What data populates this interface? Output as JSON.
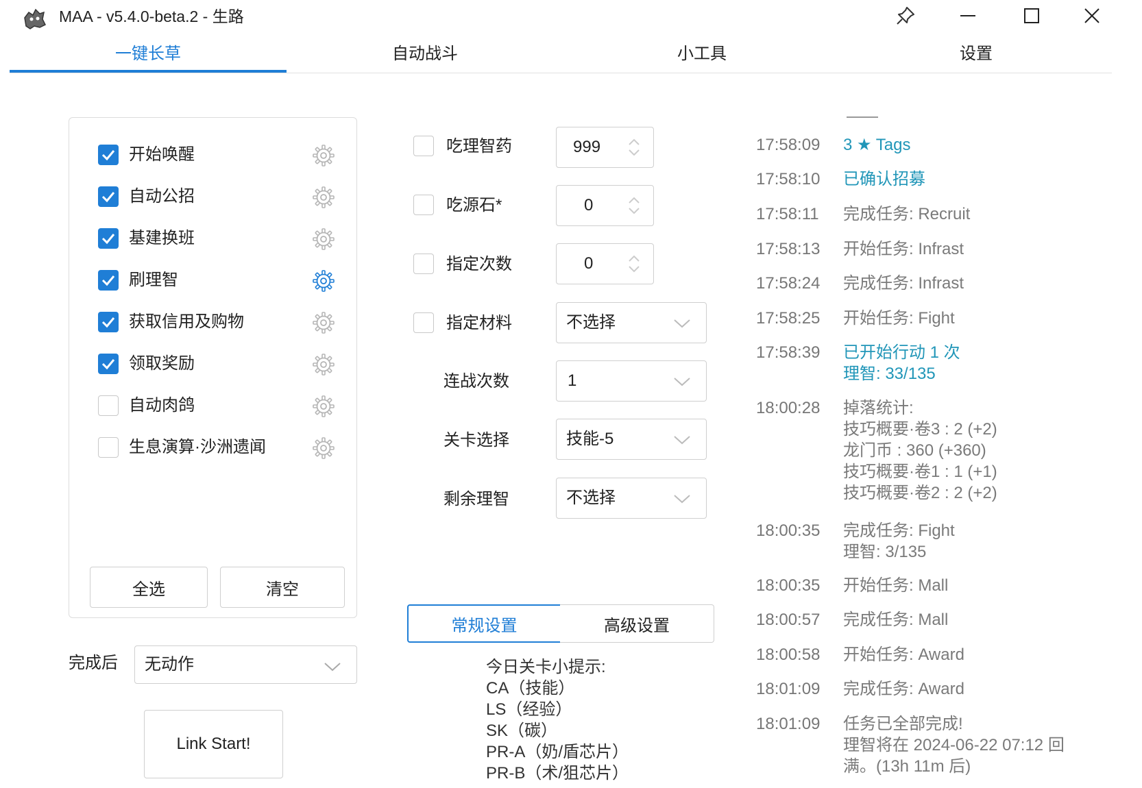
{
  "window": {
    "title": "MAA - v5.4.0-beta.2 - 生路",
    "buttons": {
      "pin": "pin-icon",
      "minimize": "minimize-icon",
      "maximize": "maximize-icon",
      "close": "close-icon"
    }
  },
  "tabs": [
    {
      "label": "一键长草",
      "active": true
    },
    {
      "label": "自动战斗",
      "active": false
    },
    {
      "label": "小工具",
      "active": false
    },
    {
      "label": "设置",
      "active": false
    }
  ],
  "tasks": [
    {
      "label": "开始唤醒",
      "checked": true
    },
    {
      "label": "自动公招",
      "checked": true
    },
    {
      "label": "基建换班",
      "checked": true
    },
    {
      "label": "刷理智",
      "checked": true,
      "selected": true
    },
    {
      "label": "获取信用及购物",
      "checked": true
    },
    {
      "label": "领取奖励",
      "checked": true
    },
    {
      "label": "自动肉鸽",
      "checked": false
    },
    {
      "label": "生息演算·沙洲遗闻",
      "checked": false
    }
  ],
  "task_buttons": {
    "select_all": "全选",
    "clear": "清空"
  },
  "after_complete": {
    "label": "完成后",
    "value": "无动作"
  },
  "link_start": "Link Start!",
  "fight": {
    "use_medicine": {
      "label": "吃理智药",
      "checked": false,
      "value": "999"
    },
    "use_stone": {
      "label": "吃源石*",
      "checked": false,
      "value": "0"
    },
    "times": {
      "label": "指定次数",
      "checked": false,
      "value": "0"
    },
    "material": {
      "label": "指定材料",
      "checked": false,
      "value": "不选择"
    },
    "series": {
      "label": "连战次数",
      "value": "1"
    },
    "stage": {
      "label": "关卡选择",
      "value": "技能-5"
    },
    "remaining": {
      "label": "剩余理智",
      "value": "不选择"
    }
  },
  "settings_tabs": {
    "general": "常规设置",
    "advanced": "高级设置"
  },
  "tips": "今日关卡小提示:\nCA（技能）\nLS（经验）\nSK（碳）\nPR-A（奶/盾芯片）\nPR-B（术/狙芯片）",
  "log": [
    {
      "time": "17:58:09",
      "msg": "3 ★ Tags",
      "color": "teal"
    },
    {
      "time": "17:58:10",
      "msg": "已确认招募",
      "color": "teal"
    },
    {
      "time": "17:58:11",
      "msg": "完成任务: Recruit",
      "color": "grey"
    },
    {
      "time": "17:58:13",
      "msg": "开始任务: Infrast",
      "color": "grey"
    },
    {
      "time": "17:58:24",
      "msg": "完成任务: Infrast",
      "color": "grey"
    },
    {
      "time": "17:58:25",
      "msg": "开始任务: Fight",
      "color": "grey"
    },
    {
      "time": "17:58:39",
      "msg": "已开始行动 1 次\n理智: 33/135",
      "color": "teal"
    },
    {
      "time": "18:00:28",
      "msg": "掉落统计:\n技巧概要·卷3 : 2 (+2)\n龙门币 : 360 (+360)\n技巧概要·卷1 : 1 (+1)\n技巧概要·卷2 : 2 (+2)",
      "color": "grey"
    },
    {
      "time": "18:00:35",
      "msg": "完成任务: Fight\n理智: 3/135",
      "color": "grey"
    },
    {
      "time": "18:00:35",
      "msg": "开始任务: Mall",
      "color": "grey"
    },
    {
      "time": "18:00:57",
      "msg": "完成任务: Mall",
      "color": "grey"
    },
    {
      "time": "18:00:58",
      "msg": "开始任务: Award",
      "color": "grey"
    },
    {
      "time": "18:01:09",
      "msg": "完成任务: Award",
      "color": "grey"
    },
    {
      "time": "18:01:09",
      "msg": "任务已全部完成!\n理智将在 2024-06-22 07:12 回\n满。(13h 11m 后)",
      "color": "grey"
    }
  ],
  "colors": {
    "accent": "#1f7ed6",
    "log_teal": "#2196b8",
    "log_grey": "#7a7a7a"
  }
}
